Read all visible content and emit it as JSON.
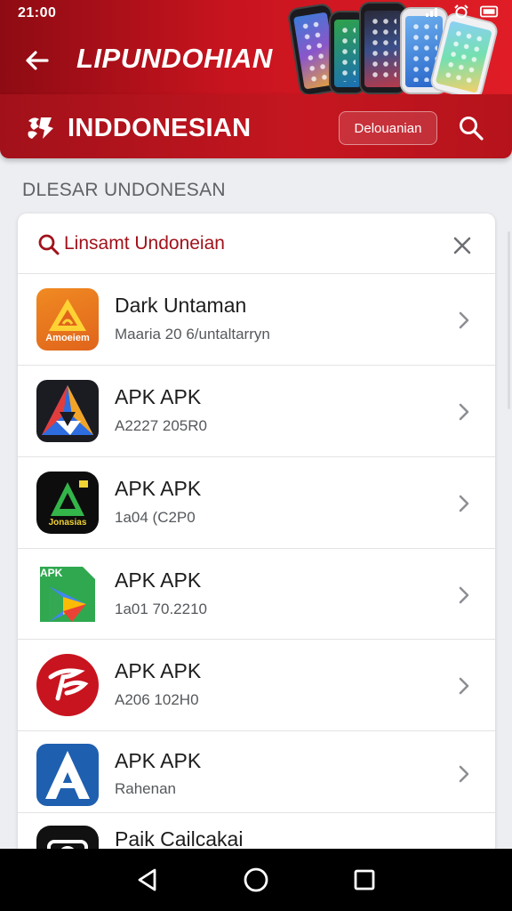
{
  "status_bar": {
    "time": "21:00"
  },
  "header": {
    "title": "LIPUNDOHIAN",
    "back_icon": "arrow-left-icon"
  },
  "brand": {
    "name": "INDDONESIAN",
    "language_button": "Delouanian",
    "search_icon": "search-icon"
  },
  "section": {
    "title": "DLESAR UNDONESAN"
  },
  "search": {
    "text": "Linsamt Undoneian",
    "clear_icon": "close-icon"
  },
  "apps": [
    {
      "name": "Dark Untaman",
      "meta": "Maaria 20 6/untaltarryn",
      "icon_label": "Amoeiem"
    },
    {
      "name": "APK APK",
      "meta": "A2227 205R0"
    },
    {
      "name": "APK APK",
      "meta": "1a04 (C2P0",
      "icon_label": "Jonasias"
    },
    {
      "name": "APK APK",
      "meta": "1a01 70.2210",
      "icon_label": "APK"
    },
    {
      "name": "APK APK",
      "meta": "A206 102H0"
    },
    {
      "name": "APK APK",
      "meta": "Rahenan"
    },
    {
      "name": "Paik Cailcakai",
      "meta": ""
    }
  ],
  "colors": {
    "brand_red": "#c51620",
    "dark_red": "#8e0b13",
    "accent_text_red": "#a1121b"
  },
  "navigation": {
    "back": "triangle-back-icon",
    "home": "circle-home-icon",
    "recents": "square-recents-icon"
  }
}
